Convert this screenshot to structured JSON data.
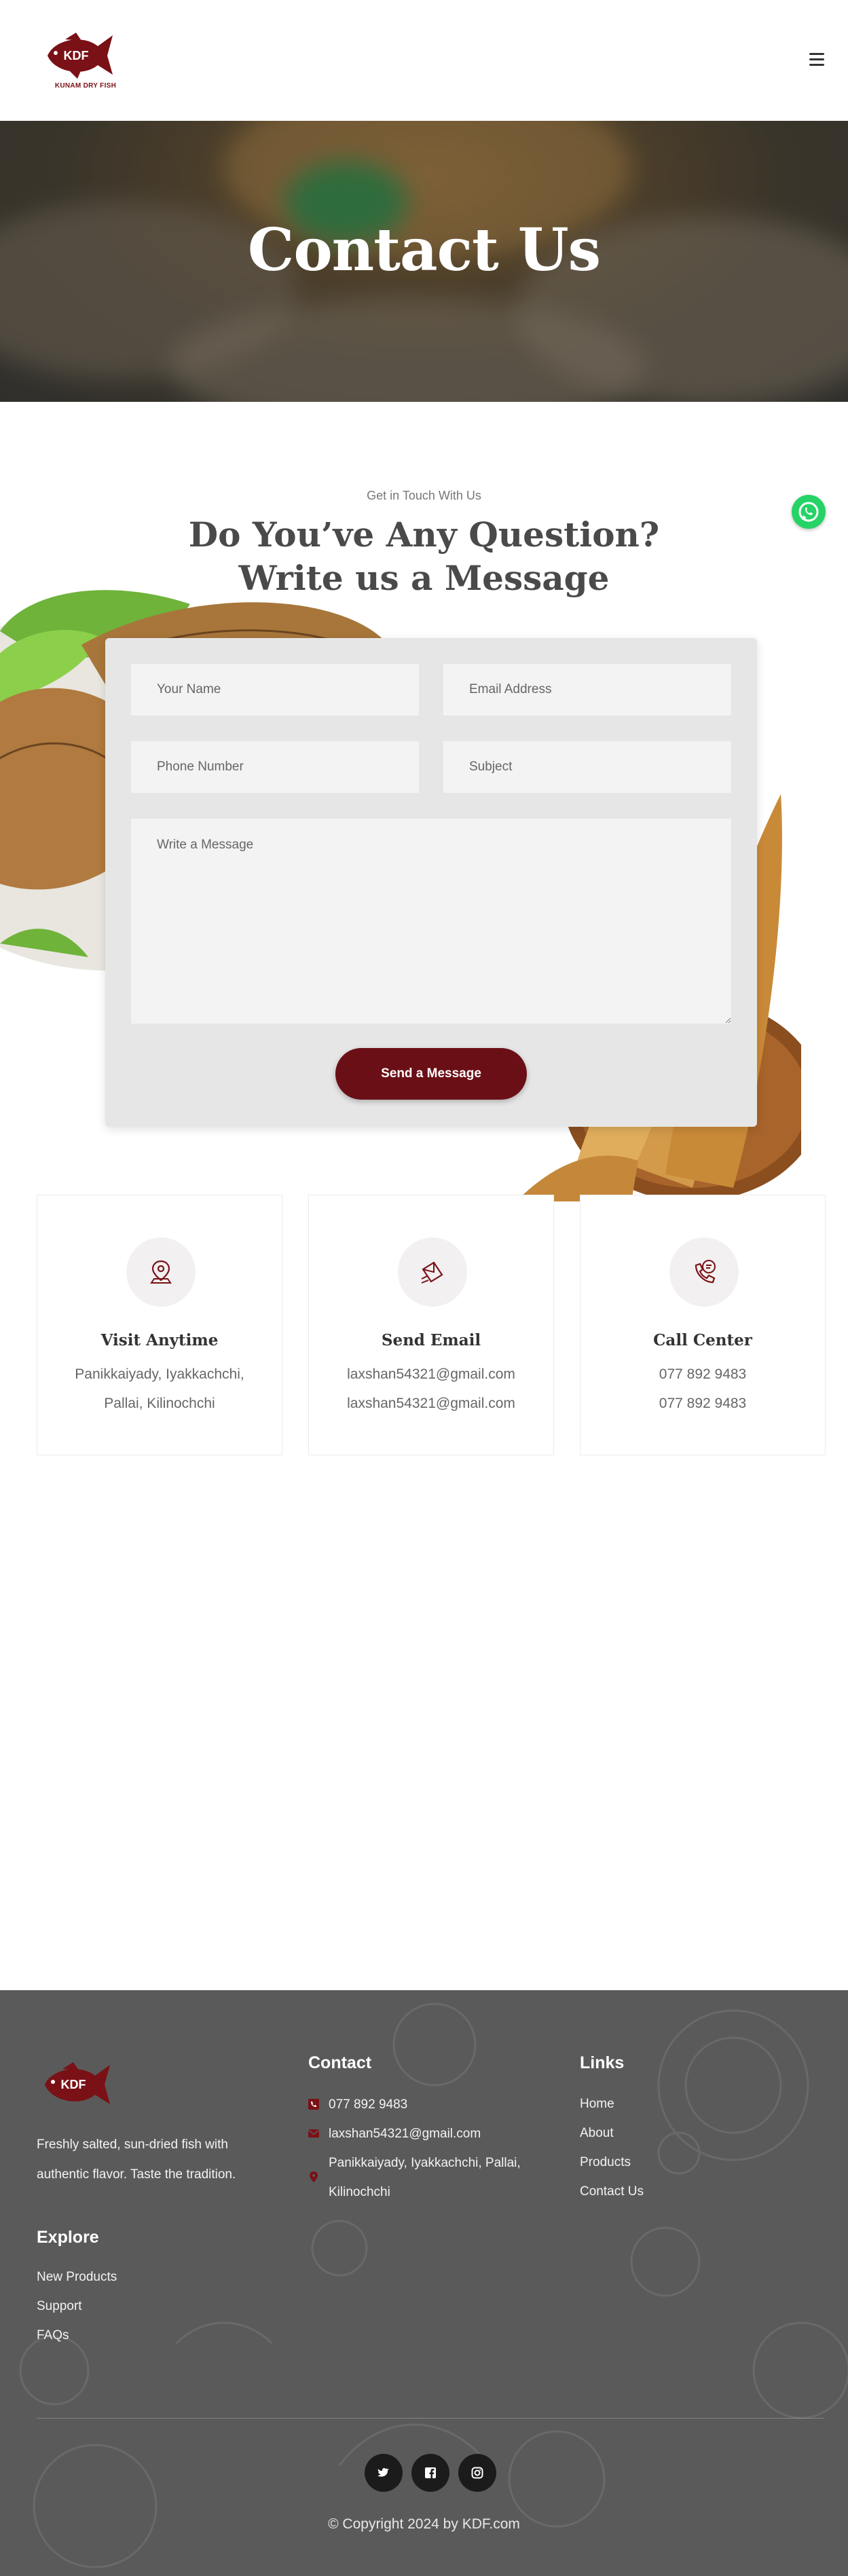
{
  "header": {
    "logo_text": "KDF",
    "logo_caption": "KUNAM DRY FISH",
    "menu_icon": "hamburger-menu-icon"
  },
  "hero": {
    "title": "Contact Us"
  },
  "contact": {
    "eyebrow": "Get in Touch With Us",
    "heading_line1": "Do You’ve Any Question?",
    "heading_line2": "Write us a Message"
  },
  "form": {
    "name_placeholder": "Your Name",
    "email_placeholder": "Email Address",
    "phone_placeholder": "Phone Number",
    "subject_placeholder": "Subject",
    "message_placeholder": "Write a Message",
    "submit_label": "Send a Message"
  },
  "info_cards": [
    {
      "icon": "location-icon",
      "title": "Visit Anytime",
      "line1": "Panikkaiyady, Iyakkachchi,",
      "line2": "Pallai, Kilinochchi"
    },
    {
      "icon": "envelope-icon",
      "title": "Send Email",
      "line1": "laxshan54321@gmail.com",
      "line2": "laxshan54321@gmail.com"
    },
    {
      "icon": "phone-icon",
      "title": "Call Center",
      "line1": "077 892 9483",
      "line2": "077 892 9483"
    }
  ],
  "footer": {
    "logo_text": "KDF",
    "about": "Freshly salted, sun-dried fish with authentic flavor. Taste the tradition.",
    "contact_heading": "Contact",
    "phone": "077 892 9483",
    "email": "laxshan54321@gmail.com",
    "address": "Panikkaiyady, Iyakkachchi, Pallai, Kilinochchi",
    "links_heading": "Links",
    "links": [
      "Home",
      "About",
      "Products",
      "Contact Us"
    ],
    "explore_heading": "Explore",
    "explore": [
      "New Products",
      "Support",
      "FAQs"
    ],
    "social": [
      "twitter-icon",
      "facebook-icon",
      "instagram-icon"
    ],
    "copyright": "© Copyright 2024 by KDF.com"
  },
  "colors": {
    "brand": "#6b0f16",
    "footer_bg": "#5a5a5a",
    "whatsapp": "#25d366"
  }
}
